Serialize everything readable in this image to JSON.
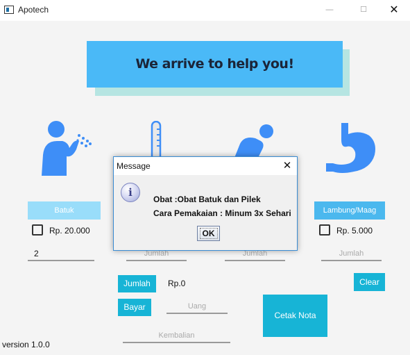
{
  "window": {
    "title": "Apotech",
    "minimize_label": "—",
    "maximize_label": "☐",
    "close_label": "✕"
  },
  "banner": {
    "text": "We arrive to help you!"
  },
  "categories": {
    "batuk": {
      "label": "Batuk",
      "price": "Rp. 20.000",
      "quantity": "2",
      "icon": "coughing-person-icon"
    },
    "demam": {
      "icon": "thermometer-icon",
      "quantity_placeholder": "Jumlah"
    },
    "diare": {
      "icon": "stomach-ache-person-icon",
      "quantity_placeholder": "Jumlah"
    },
    "maag": {
      "label": "Lambung/Maag",
      "price": "Rp. 5.000",
      "quantity_placeholder": "Jumlah",
      "icon": "stomach-icon"
    }
  },
  "actions": {
    "jumlah_label": "Jumlah",
    "bayar_label": "Bayar",
    "clear_label": "Clear",
    "cetak_nota_label": "Cetak Nota",
    "total_text": "Rp.0",
    "uang_placeholder": "Uang",
    "kembalian_placeholder": "Kembalian"
  },
  "footer": {
    "version": "version 1.0.0"
  },
  "dialog": {
    "title": "Message",
    "close_label": "✕",
    "icon_glyph": "i",
    "line1": "Obat :Obat Batuk dan Pilek",
    "line2": "Cara Pemakaian : Minum 3x Sehari",
    "ok_label": "OK"
  },
  "colors": {
    "accent": "#17b4d6",
    "banner": "#4ab9f7",
    "icon_blue": "#3e8ef7",
    "batuk_label": "#99ddfa",
    "maag_label": "#4bb8ee"
  }
}
